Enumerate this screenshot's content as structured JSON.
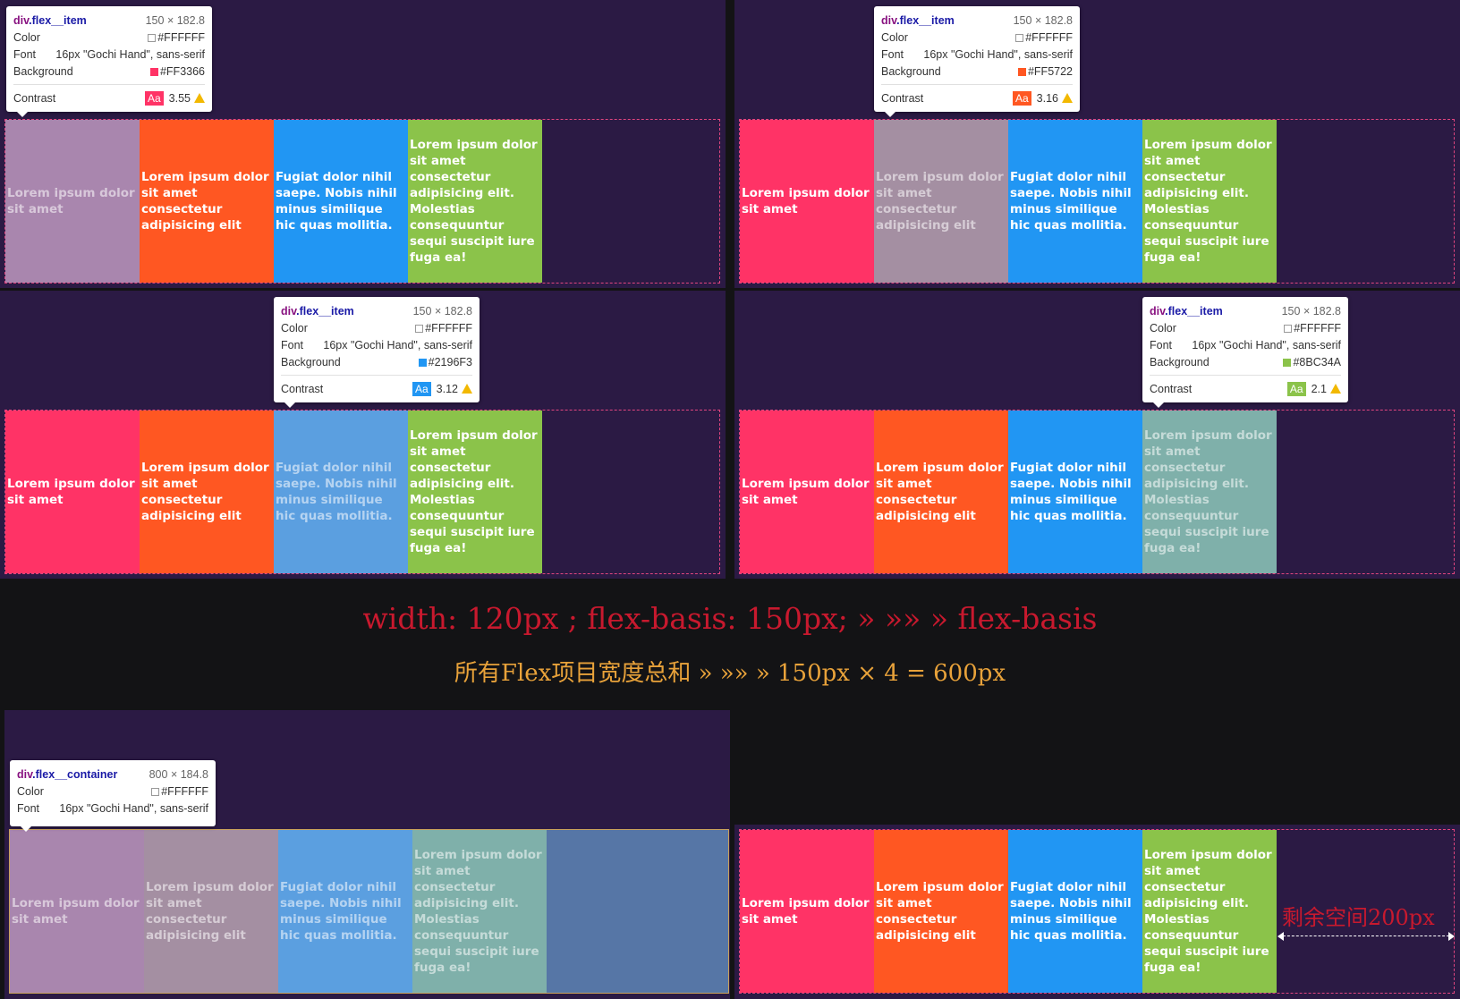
{
  "colors": {
    "pink": "#FF3366",
    "orange": "#FF5722",
    "blue": "#2196F3",
    "green": "#8BC34A",
    "panel_bg": "#2b1a44",
    "highlight_overlay": "#7fa8d8"
  },
  "items": [
    {
      "text": "Lorem ipsum dolor sit amet"
    },
    {
      "text": "Lorem ipsum dolor sit amet consectetur adipisicing elit"
    },
    {
      "text": "Fugiat dolor nihil saepe. Nobis nihil minus similique hic quas mollitia."
    },
    {
      "text": "Lorem ipsum dolor sit amet consectetur adipisicing elit. Molestias consequuntur sequi suscipit iure fuga ea!"
    }
  ],
  "tooltips": {
    "item1": {
      "tag": "div",
      "cls": ".flex__item",
      "size": "150 × 182.8",
      "color_label": "Color",
      "color_value": "#FFFFFF",
      "font_label": "Font",
      "font_value": "16px \"Gochi Hand\", sans-serif",
      "bg_label": "Background",
      "bg_value": "#FF3366",
      "contrast_label": "Contrast",
      "aa": "Aa",
      "contrast_value": "3.55"
    },
    "item2": {
      "tag": "div",
      "cls": ".flex__item",
      "size": "150 × 182.8",
      "color_label": "Color",
      "color_value": "#FFFFFF",
      "font_label": "Font",
      "font_value": "16px \"Gochi Hand\", sans-serif",
      "bg_label": "Background",
      "bg_value": "#FF5722",
      "contrast_label": "Contrast",
      "aa": "Aa",
      "contrast_value": "3.16"
    },
    "item3": {
      "tag": "div",
      "cls": ".flex__item",
      "size": "150 × 182.8",
      "color_label": "Color",
      "color_value": "#FFFFFF",
      "font_label": "Font",
      "font_value": "16px \"Gochi Hand\", sans-serif",
      "bg_label": "Background",
      "bg_value": "#2196F3",
      "contrast_label": "Contrast",
      "aa": "Aa",
      "contrast_value": "3.12"
    },
    "item4": {
      "tag": "div",
      "cls": ".flex__item",
      "size": "150 × 182.8",
      "color_label": "Color",
      "color_value": "#FFFFFF",
      "font_label": "Font",
      "font_value": "16px \"Gochi Hand\", sans-serif",
      "bg_label": "Background",
      "bg_value": "#8BC34A",
      "contrast_label": "Contrast",
      "aa": "Aa",
      "contrast_value": "2.1"
    },
    "container": {
      "tag": "div",
      "cls": ".flex__container",
      "size": "800 × 184.8",
      "color_label": "Color",
      "color_value": "#FFFFFF",
      "font_label": "Font",
      "font_value": "16px \"Gochi Hand\", sans-serif"
    }
  },
  "captions": {
    "line1": "width: 120px ; flex-basis: 150px;  » »» » flex-basis",
    "line2": "所有Flex项目宽度总和 » »» » 150px  ×  4  =  600px"
  },
  "free_space_label": "剩余空间200px"
}
